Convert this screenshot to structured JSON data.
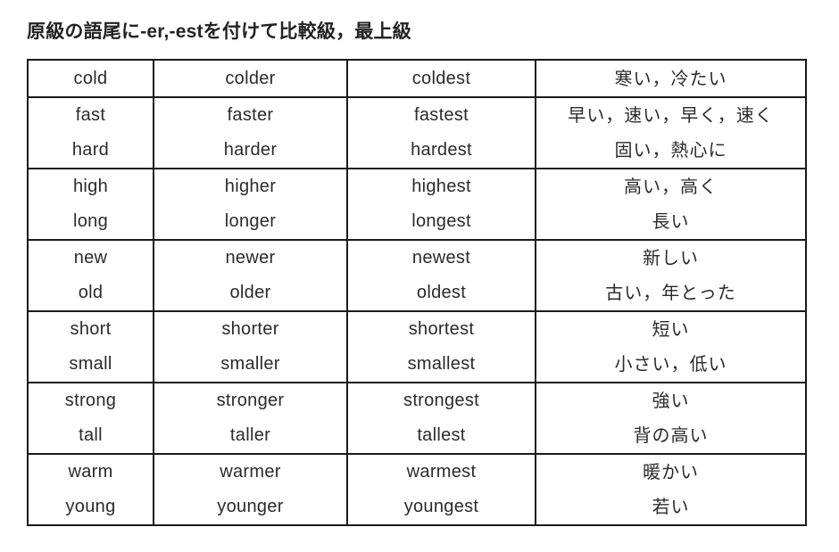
{
  "title": "原級の語尾に-er,-estを付けて比較級，最上級",
  "table": {
    "columns": [
      "base",
      "comparative",
      "superlative",
      "meaning"
    ],
    "groups": [
      {
        "rows": [
          {
            "base": "cold",
            "comparative": "colder",
            "superlative": "coldest",
            "meaning": "寒い，冷たい"
          }
        ]
      },
      {
        "rows": [
          {
            "base": "fast",
            "comparative": "faster",
            "superlative": "fastest",
            "meaning": "早い，速い，早く，速く"
          },
          {
            "base": "hard",
            "comparative": "harder",
            "superlative": "hardest",
            "meaning": "固い，熱心に"
          }
        ]
      },
      {
        "rows": [
          {
            "base": "high",
            "comparative": "higher",
            "superlative": "highest",
            "meaning": "高い，高く"
          },
          {
            "base": "long",
            "comparative": "longer",
            "superlative": "longest",
            "meaning": "長い"
          }
        ]
      },
      {
        "rows": [
          {
            "base": "new",
            "comparative": "newer",
            "superlative": "newest",
            "meaning": "新しい"
          },
          {
            "base": "old",
            "comparative": "older",
            "superlative": "oldest",
            "meaning": "古い，年とった"
          }
        ]
      },
      {
        "rows": [
          {
            "base": "short",
            "comparative": "shorter",
            "superlative": "shortest",
            "meaning": "短い"
          },
          {
            "base": "small",
            "comparative": "smaller",
            "superlative": "smallest",
            "meaning": "小さい，低い"
          }
        ]
      },
      {
        "rows": [
          {
            "base": "strong",
            "comparative": "stronger",
            "superlative": "strongest",
            "meaning": "強い"
          },
          {
            "base": "tall",
            "comparative": "taller",
            "superlative": "tallest",
            "meaning": "背の高い"
          }
        ]
      },
      {
        "rows": [
          {
            "base": "warm",
            "comparative": "warmer",
            "superlative": "warmest",
            "meaning": "暖かい"
          },
          {
            "base": "young",
            "comparative": "younger",
            "superlative": "youngest",
            "meaning": "若い"
          }
        ]
      }
    ]
  },
  "colors": {
    "background": "#ffffff",
    "border": "#1a1a1a",
    "title_text": "#222222",
    "cell_text": "#2b2b2b"
  }
}
